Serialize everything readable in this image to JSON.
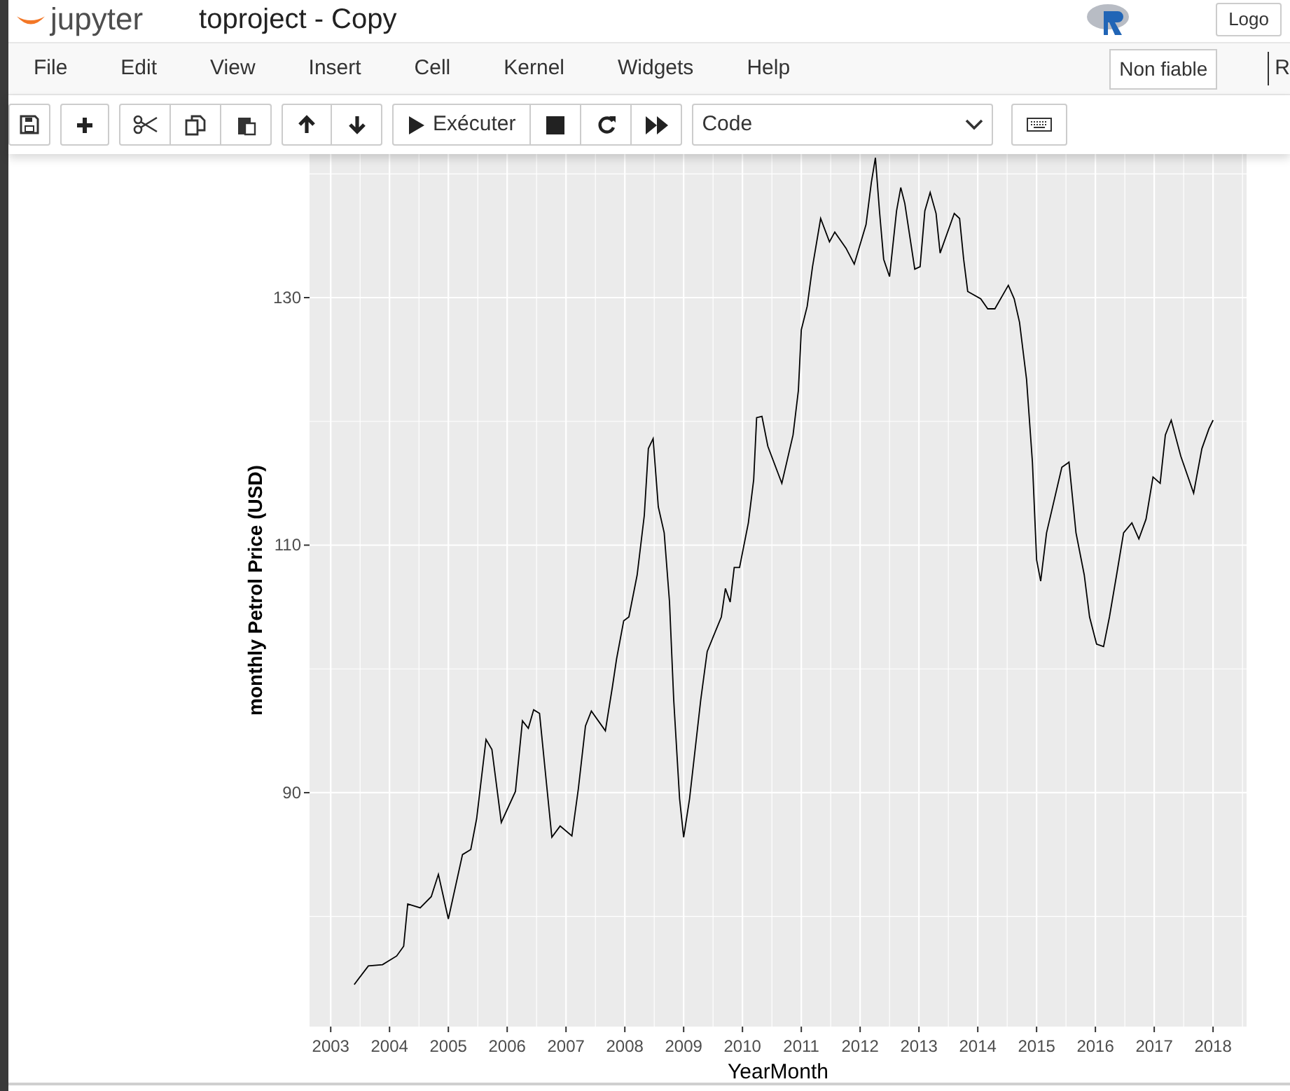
{
  "header": {
    "logo": "jupyter",
    "title": "toproject - Copy",
    "logout": "Logo"
  },
  "menu": {
    "items": [
      "File",
      "Edit",
      "View",
      "Insert",
      "Cell",
      "Kernel",
      "Widgets",
      "Help"
    ],
    "trust": "Non fiable",
    "kernel": "R"
  },
  "toolbar": {
    "run_label": "Exécuter",
    "cell_type": "Code"
  },
  "output": {
    "chart_data": {
      "type": "line",
      "xlabel": "YearMonth",
      "ylabel": "monthly Petrol Price (USD)",
      "xlim": [
        2002.64,
        2018.57
      ],
      "ylim": [
        71.1,
        141.6
      ],
      "xticks": [
        2003,
        2004,
        2005,
        2006,
        2007,
        2008,
        2009,
        2010,
        2011,
        2012,
        2013,
        2014,
        2015,
        2016,
        2017,
        2018
      ],
      "yticks": [
        90,
        110,
        130
      ],
      "x": [
        2003.4,
        2003.64,
        2003.88,
        2004.12,
        2004.24,
        2004.31,
        2004.52,
        2004.71,
        2004.83,
        2005.0,
        2005.24,
        2005.38,
        2005.48,
        2005.64,
        2005.74,
        2005.9,
        2006.14,
        2006.26,
        2006.36,
        2006.45,
        2006.55,
        2006.67,
        2006.76,
        2006.9,
        2007.1,
        2007.21,
        2007.33,
        2007.43,
        2007.67,
        2007.79,
        2007.86,
        2007.98,
        2008.07,
        2008.21,
        2008.33,
        2008.4,
        2008.48,
        2008.57,
        2008.67,
        2008.76,
        2008.83,
        2008.93,
        2009.0,
        2009.1,
        2009.29,
        2009.4,
        2009.64,
        2009.71,
        2009.79,
        2009.86,
        2009.95,
        2010.1,
        2010.19,
        2010.24,
        2010.33,
        2010.43,
        2010.67,
        2010.86,
        2010.95,
        2011.0,
        2011.1,
        2011.19,
        2011.33,
        2011.48,
        2011.57,
        2011.76,
        2011.9,
        2012.1,
        2012.19,
        2012.26,
        2012.33,
        2012.4,
        2012.5,
        2012.62,
        2012.69,
        2012.76,
        2012.93,
        2013.02,
        2013.1,
        2013.19,
        2013.29,
        2013.36,
        2013.6,
        2013.69,
        2013.76,
        2013.83,
        2014.05,
        2014.17,
        2014.29,
        2014.52,
        2014.62,
        2014.71,
        2014.83,
        2014.93,
        2015.0,
        2015.07,
        2015.17,
        2015.43,
        2015.55,
        2015.67,
        2015.81,
        2015.9,
        2016.02,
        2016.14,
        2016.24,
        2016.36,
        2016.48,
        2016.62,
        2016.74,
        2016.86,
        2016.98,
        2017.1,
        2017.19,
        2017.29,
        2017.45,
        2017.67,
        2017.81,
        2017.93,
        2018.0
      ],
      "grid": true,
      "series": [
        {
          "color": "#000000",
          "values": [
            74.5,
            76.0,
            76.1,
            76.8,
            77.6,
            81.0,
            80.7,
            81.6,
            83.4,
            79.8,
            85.0,
            85.4,
            87.9,
            94.3,
            93.5,
            87.6,
            90.1,
            95.8,
            95.2,
            96.7,
            96.4,
            90.7,
            86.4,
            87.3,
            86.5,
            90.3,
            95.4,
            96.6,
            95.0,
            98.6,
            100.8,
            103.9,
            104.2,
            107.6,
            112.4,
            117.8,
            118.6,
            113.1,
            111.0,
            105.4,
            97.5,
            89.5,
            86.4,
            89.5,
            97.5,
            101.4,
            104.2,
            106.5,
            105.4,
            108.2,
            108.2,
            111.8,
            115.3,
            120.3,
            120.4,
            118.0,
            115.0,
            118.9,
            122.5,
            127.4,
            129.3,
            132.5,
            136.4,
            134.5,
            135.3,
            134.0,
            132.7,
            135.9,
            139.3,
            141.3,
            137.0,
            133.1,
            131.7,
            137.0,
            138.9,
            137.6,
            132.3,
            132.5,
            137.0,
            138.5,
            136.8,
            133.6,
            136.8,
            136.4,
            133.1,
            130.5,
            129.9,
            129.1,
            129.1,
            131.0,
            129.9,
            128.0,
            123.4,
            116.7,
            108.8,
            107.1,
            111.0,
            116.3,
            116.7,
            111.0,
            107.6,
            104.2,
            102.0,
            101.8,
            104.2,
            107.6,
            111.0,
            111.8,
            110.5,
            112.1,
            115.5,
            115.0,
            118.9,
            120.1,
            117.2,
            114.2,
            117.8,
            119.4,
            120.1
          ]
        }
      ]
    }
  }
}
